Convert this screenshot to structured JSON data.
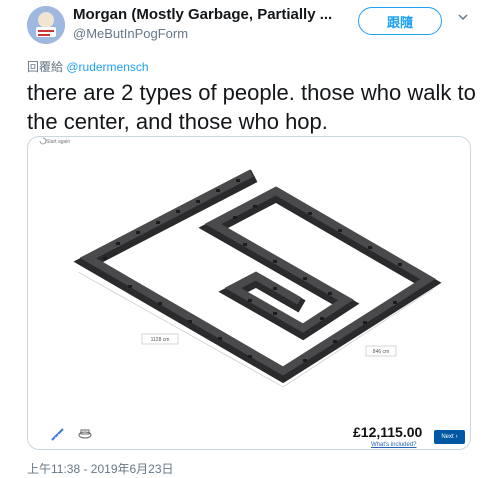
{
  "author": {
    "display_name": "Morgan (Mostly Garbage, Partially ...",
    "handle": "@MeButInPogForm"
  },
  "follow_button_label": "跟隨",
  "reply_context": {
    "prefix": "回覆給",
    "mention": "@rudermensch"
  },
  "tweet_text": "there are 2 types of people. those who walk to the center, and those who hop.",
  "media": {
    "start_again_label": "Start again",
    "dimension_left": "1128 cm",
    "dimension_right": "846 cm",
    "price": "£12,115.00",
    "whats_included": "What's included?",
    "next_label": "Next"
  },
  "timestamp": "上午11:38 - 2019年6月23日",
  "colors": {
    "accent": "#1da1f2",
    "ikea_blue": "#0058a3",
    "wall": "#3a3a3c"
  }
}
